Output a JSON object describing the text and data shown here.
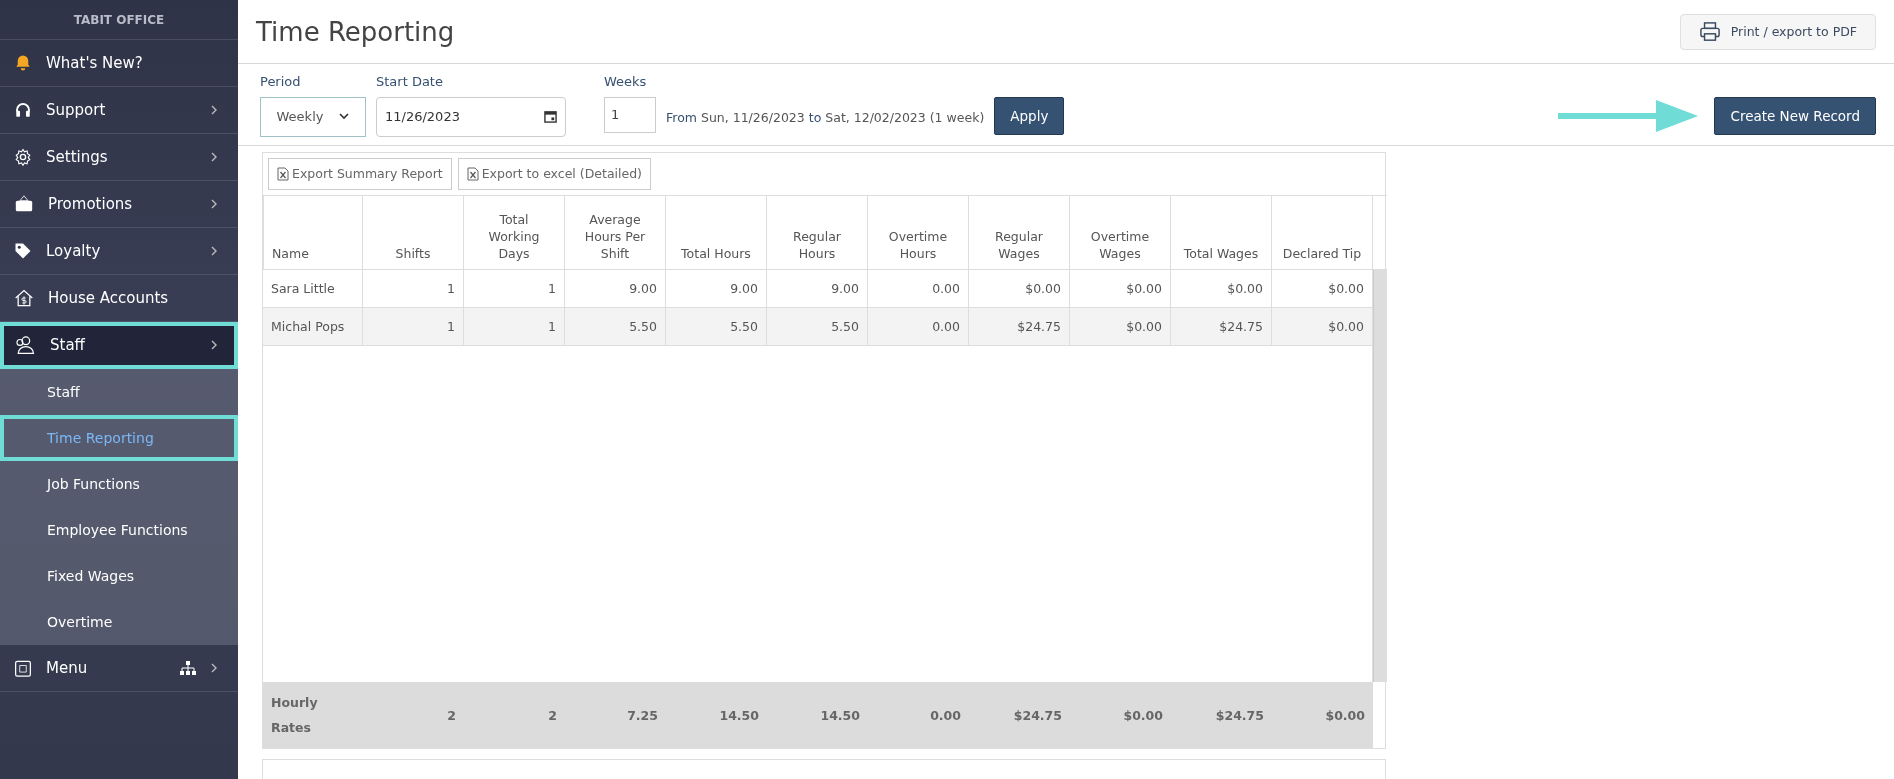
{
  "sidebar": {
    "brand": "TABIT OFFICE",
    "items": [
      {
        "label": "What's New?",
        "chevron": false,
        "highlighted": false,
        "expanded": false
      },
      {
        "label": "Support",
        "chevron": true,
        "highlighted": false,
        "expanded": false
      },
      {
        "label": "Settings",
        "chevron": true,
        "highlighted": false,
        "expanded": false
      },
      {
        "label": "Promotions",
        "chevron": true,
        "highlighted": false,
        "expanded": false
      },
      {
        "label": "Loyalty",
        "chevron": true,
        "highlighted": false,
        "expanded": false
      },
      {
        "label": "House Accounts",
        "chevron": false,
        "highlighted": false,
        "expanded": false
      },
      {
        "label": "Staff",
        "chevron": true,
        "highlighted": true,
        "expanded": true,
        "children": [
          {
            "label": "Staff",
            "selected": false,
            "highlighted": false
          },
          {
            "label": "Time Reporting",
            "selected": true,
            "highlighted": true
          },
          {
            "label": "Job Functions",
            "selected": false,
            "highlighted": false
          },
          {
            "label": "Employee Functions",
            "selected": false,
            "highlighted": false
          },
          {
            "label": "Fixed Wages",
            "selected": false,
            "highlighted": false
          },
          {
            "label": "Overtime",
            "selected": false,
            "highlighted": false
          }
        ]
      },
      {
        "label": "Menu",
        "chevron": true,
        "highlighted": false,
        "expanded": false,
        "extra_icon": true
      }
    ]
  },
  "header": {
    "title": "Time Reporting",
    "print_button": "Print / export to PDF"
  },
  "filters": {
    "period": {
      "label": "Period",
      "value": "Weekly"
    },
    "start_date": {
      "label": "Start Date",
      "value": "11/26/2023"
    },
    "weeks": {
      "label": "Weeks",
      "value": "1"
    },
    "range": {
      "from_label": "From",
      "from": "Sun, 11/26/2023",
      "to_label": "to",
      "to": "Sat, 12/02/2023 (1 week)"
    },
    "apply": "Apply",
    "create": "Create New Record"
  },
  "exports": [
    "Export Summary Report",
    "Export to excel (Detailed)"
  ],
  "table": {
    "columns": [
      "Name",
      "Shifts",
      "Total Working Days",
      "Average Hours Per Shift",
      "Total Hours",
      "Regular Hours",
      "Overtime Hours",
      "Regular Wages",
      "Overtime Wages",
      "Total Wages",
      "Declared Tip"
    ],
    "rows": [
      [
        "Sara Little",
        "1",
        "1",
        "9.00",
        "9.00",
        "9.00",
        "0.00",
        "$0.00",
        "$0.00",
        "$0.00",
        "$0.00"
      ],
      [
        "Michal Pops",
        "1",
        "1",
        "5.50",
        "5.50",
        "5.50",
        "0.00",
        "$24.75",
        "$0.00",
        "$24.75",
        "$0.00"
      ]
    ],
    "footer": [
      "Hourly Rates",
      "2",
      "2",
      "7.25",
      "14.50",
      "14.50",
      "0.00",
      "$24.75",
      "$0.00",
      "$24.75",
      "$0.00"
    ]
  }
}
